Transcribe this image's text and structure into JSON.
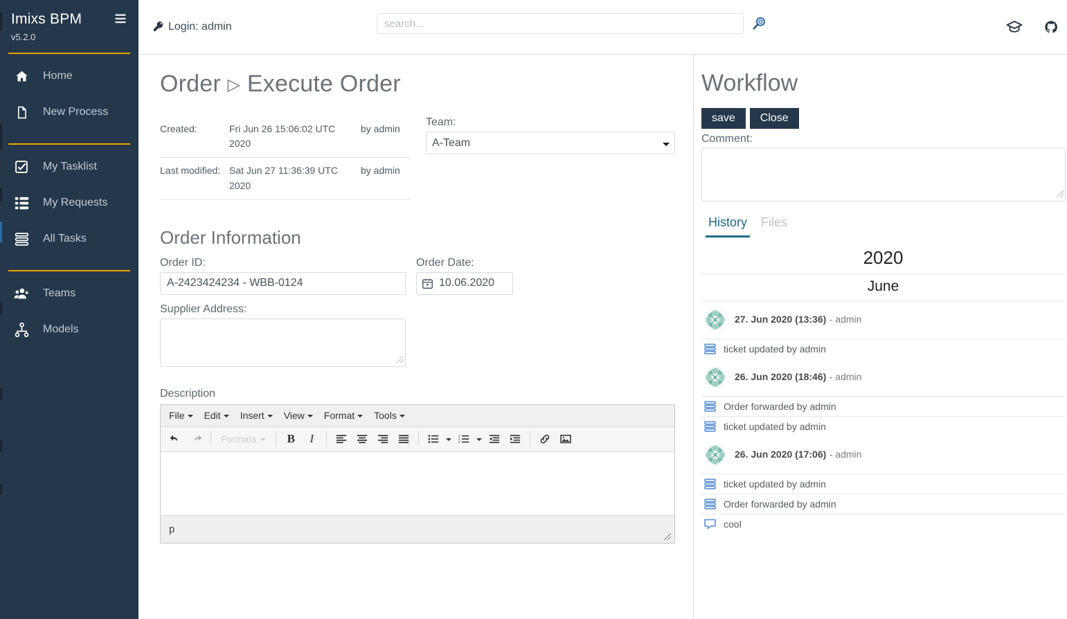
{
  "sidebar": {
    "brand": "Imixs BPM",
    "brand_icon": "stacked-layers-icon",
    "version": "v5.2.0",
    "groups": [
      {
        "items": [
          {
            "label": "Home",
            "icon": "home-icon"
          },
          {
            "label": "New Process",
            "icon": "file-icon"
          }
        ]
      },
      {
        "items": [
          {
            "label": "My Tasklist",
            "icon": "check-square-icon"
          },
          {
            "label": "My Requests",
            "icon": "grid-list-icon"
          },
          {
            "label": "All Tasks",
            "icon": "stacked-layers-icon"
          }
        ]
      },
      {
        "items": [
          {
            "label": "Teams",
            "icon": "users-icon"
          },
          {
            "label": "Models",
            "icon": "sitemap-icon"
          }
        ]
      }
    ],
    "accent_color": "#f0a500",
    "background_color": "#25374a"
  },
  "header": {
    "login_label": "Login: admin",
    "login_icon": "key-icon",
    "search": {
      "value": "",
      "placeholder": "search...",
      "button_icon": "search-icon"
    },
    "icons": [
      {
        "name": "graduation-cap-icon"
      },
      {
        "name": "github-icon"
      }
    ]
  },
  "page": {
    "title_main": "Order",
    "title_sep": "▷",
    "title_sub": "Execute Order",
    "meta": [
      {
        "label": "Created:",
        "value": "Fri Jun 26 15:06:02 UTC 2020",
        "by": "by admin"
      },
      {
        "label": "Last modified:",
        "value": "Sat Jun 27 11:36:39 UTC 2020",
        "by": "by admin"
      }
    ],
    "team": {
      "label": "Team:",
      "selected": "A-Team",
      "options": [
        "A-Team"
      ]
    },
    "section_title": "Order Information",
    "order_id": {
      "label": "Order ID:",
      "value": "A-2423424234 - WBB-0124"
    },
    "order_date": {
      "label": "Order Date:",
      "value": "10.06.2020",
      "icon": "calendar-icon"
    },
    "supplier_address": {
      "label": "Supplier Address:",
      "value": ""
    },
    "description": {
      "label": "Description",
      "content": "",
      "menus": [
        "File",
        "Edit",
        "Insert",
        "View",
        "Format",
        "Tools"
      ],
      "toolbar": [
        {
          "name": "undo-icon"
        },
        {
          "name": "redo-icon"
        },
        {
          "name": "formats-dropdown",
          "label": "Formats"
        },
        {
          "name": "bold-icon",
          "label": "B"
        },
        {
          "name": "italic-icon",
          "label": "I"
        },
        {
          "name": "align-left-icon"
        },
        {
          "name": "align-center-icon"
        },
        {
          "name": "align-right-icon"
        },
        {
          "name": "align-justify-icon"
        },
        {
          "name": "bullet-list-icon"
        },
        {
          "name": "numbered-list-icon"
        },
        {
          "name": "outdent-icon"
        },
        {
          "name": "indent-icon"
        },
        {
          "name": "link-icon"
        },
        {
          "name": "image-icon"
        }
      ],
      "status_path": "p"
    }
  },
  "workflow": {
    "title": "Workflow",
    "save_label": "save",
    "close_label": "Close",
    "comment_label": "Comment:",
    "comment_value": "",
    "tabs": [
      {
        "label": "History",
        "active": true
      },
      {
        "label": "Files",
        "active": false
      }
    ],
    "history": {
      "year": "2020",
      "month": "June",
      "entries": [
        {
          "avatar": "identicon-avatar",
          "date": "27. Jun 2020 (13:36)",
          "user": "- admin",
          "lines": [
            {
              "icon": "stacked-layers-icon",
              "text": "ticket updated by admin"
            }
          ]
        },
        {
          "avatar": "identicon-avatar",
          "date": "26. Jun 2020 (18:46)",
          "user": "- admin",
          "lines": [
            {
              "icon": "stacked-layers-icon",
              "text": "Order forwarded by admin"
            },
            {
              "icon": "stacked-layers-icon",
              "text": "ticket updated by admin"
            }
          ]
        },
        {
          "avatar": "identicon-avatar",
          "date": "26. Jun 2020 (17:06)",
          "user": "- admin",
          "lines": [
            {
              "icon": "stacked-layers-icon",
              "text": "ticket updated by admin"
            },
            {
              "icon": "stacked-layers-icon",
              "text": "Order forwarded by admin"
            },
            {
              "icon": "comment-icon",
              "text": "cool"
            }
          ]
        }
      ]
    }
  }
}
